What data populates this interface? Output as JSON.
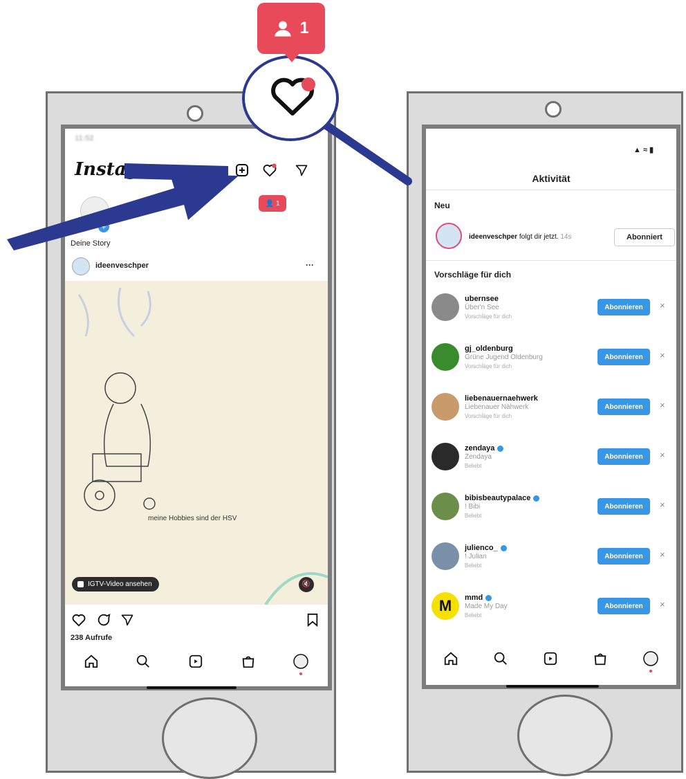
{
  "badge_big": {
    "count": "1",
    "color": "#e84a5a"
  },
  "left_phone": {
    "status_time": "11:52",
    "app_logo": "Instagram",
    "badge_count": "1",
    "story": {
      "label": "Deine Story"
    },
    "post": {
      "username": "ideenveschper",
      "more": "···",
      "caption_in_image": "meine Hobbies sind der HSV",
      "igtv_label": "IGTV-Video ansehen",
      "views": "238 Aufrufe"
    }
  },
  "right_phone": {
    "title": "Aktivität",
    "section_new": "Neu",
    "new_item": {
      "username": "ideenveschper",
      "text": "folgt dir jetzt.",
      "time": "14s",
      "button": "Abonniert"
    },
    "section_suggestions": "Vorschläge für dich",
    "follow_label": "Abonnieren",
    "close_label": "×",
    "suggestions": [
      {
        "username": "ubernsee",
        "fullname": "Über'n See",
        "hint": "Vorschläge für dich",
        "color": "#8a8a8a"
      },
      {
        "username": "gj_oldenburg",
        "fullname": "Grüne Jugend Oldenburg",
        "hint": "Vorschläge für dich",
        "color": "#3a8a2e"
      },
      {
        "username": "liebenauernaehwerk",
        "fullname": "Liebenauer Nähwerk",
        "hint": "Vorschläge für dich",
        "color": "#c99a6a"
      },
      {
        "username": "zendaya",
        "fullname": "Zendaya",
        "hint": "Beliebt",
        "color": "#2a2a2a"
      },
      {
        "username": "bibisbeautypalace",
        "fullname": "! Bibi",
        "hint": "Beliebt",
        "color": "#6b8f4a"
      },
      {
        "username": "julienco_",
        "fullname": "! Julian",
        "hint": "Beliebt",
        "color": "#7a8fa8"
      },
      {
        "username": "mmd",
        "fullname": "Made My Day",
        "hint": "Beliebt",
        "color": "#f5e000"
      }
    ]
  },
  "colors": {
    "accent_blue": "#3797e6",
    "arrow_navy": "#2b3990",
    "badge_red": "#e84a5a"
  }
}
